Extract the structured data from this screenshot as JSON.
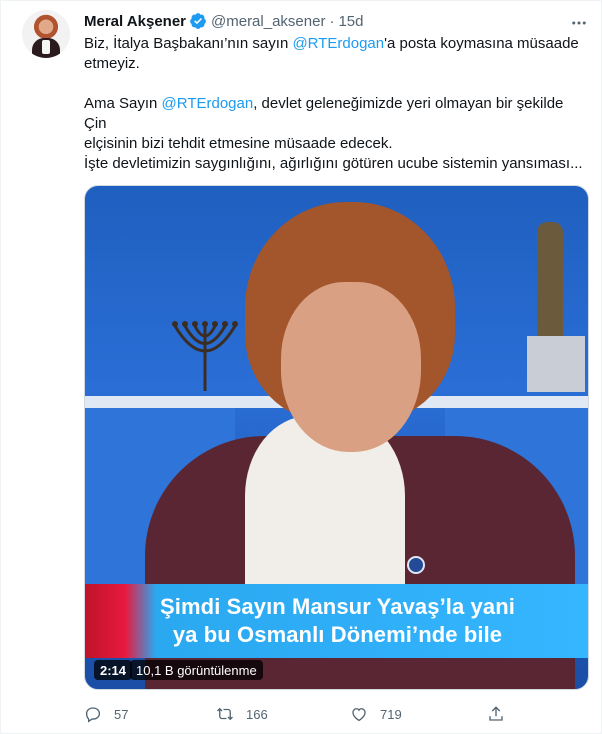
{
  "tweet": {
    "author": {
      "name": "Meral Akşener",
      "handle": "@meral_aksener",
      "dot": "·",
      "time": "15d",
      "verified": true
    },
    "text": {
      "p1_a": "Biz, İtalya Başbakanı’nın sayın ",
      "p1_mention": "@RTErdogan",
      "p1_b": "'a posta koymasına müsaade",
      "p1_c": "etmeyiz.",
      "p2_a": "Ama Sayın ",
      "p2_mention": "@RTErdogan",
      "p2_b": ", devlet geleneğimizde yeri olmayan bir şekilde Çin",
      "p2_c": "elçisinin bizi tehdit etmesine müsaade edecek.",
      "p3": "İşte devletimizin saygınlığını, ağırlığını götüren ucube sistemin yansıması..."
    },
    "video": {
      "caption_line1": "Şimdi Sayın Mansur Yavaş’la yani",
      "caption_line2": "ya bu Osmanlı Dönemi’nde bile",
      "duration": "2:14",
      "views": "10,1 B görüntülenme"
    },
    "actions": {
      "replies": "57",
      "retweets": "166",
      "likes": "719"
    }
  },
  "icons": {
    "verified": "verified-badge-icon",
    "more": "more-icon",
    "reply": "reply-icon",
    "retweet": "retweet-icon",
    "like": "like-icon",
    "share": "share-icon"
  },
  "colors": {
    "mention": "#1d9bf0",
    "secondary_text": "#536471",
    "verified": "#1d9bf0"
  }
}
